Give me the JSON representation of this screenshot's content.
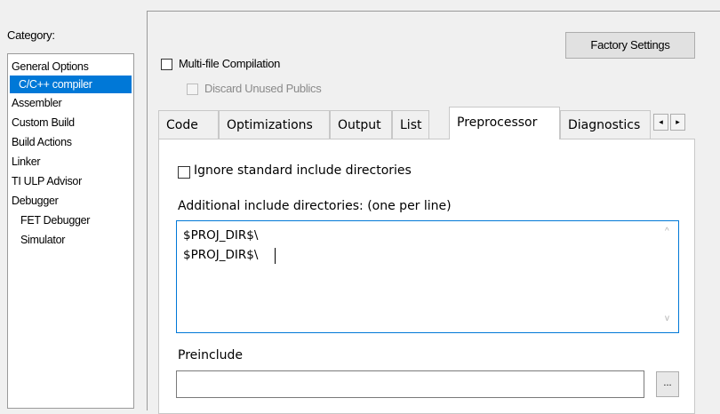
{
  "category": {
    "label": "Category:",
    "items": [
      {
        "label": "General Options"
      },
      {
        "label": "C/C++ compiler"
      },
      {
        "label": "Assembler"
      },
      {
        "label": "Custom Build"
      },
      {
        "label": "Build Actions"
      },
      {
        "label": "Linker"
      },
      {
        "label": "TI ULP Advisor"
      },
      {
        "label": "Debugger"
      },
      {
        "label": "FET Debugger"
      },
      {
        "label": "Simulator"
      }
    ]
  },
  "factory_settings_label": "Factory Settings",
  "multifile": {
    "label": "Multi-file Compilation",
    "checked": false
  },
  "discard": {
    "label": "Discard Unused Publics",
    "checked": false,
    "disabled": true
  },
  "tabs": [
    {
      "label": "Code"
    },
    {
      "label": "Optimizations"
    },
    {
      "label": "Output"
    },
    {
      "label": "List"
    },
    {
      "label": "Preprocessor",
      "active": true
    },
    {
      "label": "Diagnostics"
    }
  ],
  "tab_scroll": {
    "left": "◂",
    "right": "▸"
  },
  "ignore_std": {
    "label": "Ignore standard include directories",
    "checked": false
  },
  "additional_include": {
    "label": "Additional include directories: (one per line)",
    "lines": [
      "$PROJ_DIR$\\",
      "$PROJ_DIR$\\"
    ]
  },
  "scroll_glyphs": {
    "up": "^",
    "down": "v"
  },
  "preinclude": {
    "label": "Preinclude",
    "value": "",
    "browse_label": "..."
  }
}
